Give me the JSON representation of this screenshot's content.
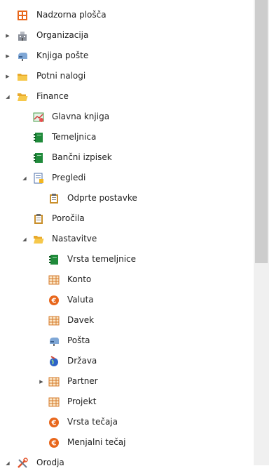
{
  "tree": [
    {
      "label": "Nadzorna plošča",
      "level": 0,
      "expander": "none",
      "icon": "dashboard-icon"
    },
    {
      "label": "Organizacija",
      "level": 0,
      "expander": "collapsed",
      "icon": "building-icon"
    },
    {
      "label": "Knjiga pošte",
      "level": 0,
      "expander": "collapsed",
      "icon": "mailbox-icon"
    },
    {
      "label": "Potni nalogi",
      "level": 0,
      "expander": "collapsed",
      "icon": "folder-icon"
    },
    {
      "label": "Finance",
      "level": 0,
      "expander": "expanded",
      "icon": "folder-open-icon"
    },
    {
      "label": "Glavna knjiga",
      "level": 1,
      "expander": "none",
      "icon": "chart-icon"
    },
    {
      "label": "Temeljnica",
      "level": 1,
      "expander": "none",
      "icon": "ledger-icon"
    },
    {
      "label": "Bančni izpisek",
      "level": 1,
      "expander": "none",
      "icon": "ledger-icon"
    },
    {
      "label": "Pregledi",
      "level": 1,
      "expander": "expanded",
      "icon": "report-list-icon"
    },
    {
      "label": "Odprte postavke",
      "level": 2,
      "expander": "none",
      "icon": "clipboard-icon"
    },
    {
      "label": "Poročila",
      "level": 1,
      "expander": "none",
      "icon": "clipboard-icon"
    },
    {
      "label": "Nastavitve",
      "level": 1,
      "expander": "expanded",
      "icon": "folder-open-icon"
    },
    {
      "label": "Vrsta temeljnice",
      "level": 2,
      "expander": "none",
      "icon": "ledger-icon"
    },
    {
      "label": "Konto",
      "level": 2,
      "expander": "none",
      "icon": "table-icon"
    },
    {
      "label": "Valuta",
      "level": 2,
      "expander": "none",
      "icon": "euro-icon"
    },
    {
      "label": "Davek",
      "level": 2,
      "expander": "none",
      "icon": "table-icon"
    },
    {
      "label": "Pošta",
      "level": 2,
      "expander": "none",
      "icon": "mailbox-icon"
    },
    {
      "label": "Država",
      "level": 2,
      "expander": "none",
      "icon": "globe-icon"
    },
    {
      "label": "Partner",
      "level": 2,
      "expander": "collapsed",
      "icon": "table-icon"
    },
    {
      "label": "Projekt",
      "level": 2,
      "expander": "none",
      "icon": "table-icon"
    },
    {
      "label": "Vrsta tečaja",
      "level": 2,
      "expander": "none",
      "icon": "euro-icon"
    },
    {
      "label": "Menjalni tečaj",
      "level": 2,
      "expander": "none",
      "icon": "euro-icon"
    },
    {
      "label": "Orodja",
      "level": 0,
      "expander": "expanded",
      "icon": "tools-icon"
    }
  ],
  "colors": {
    "folder": "#e8a92b",
    "ledger": "#1f8a3a",
    "euro": "#e8671c",
    "table_border": "#d47a2a",
    "table_fill": "#fbe7c8",
    "globe": "#2d63c8"
  }
}
